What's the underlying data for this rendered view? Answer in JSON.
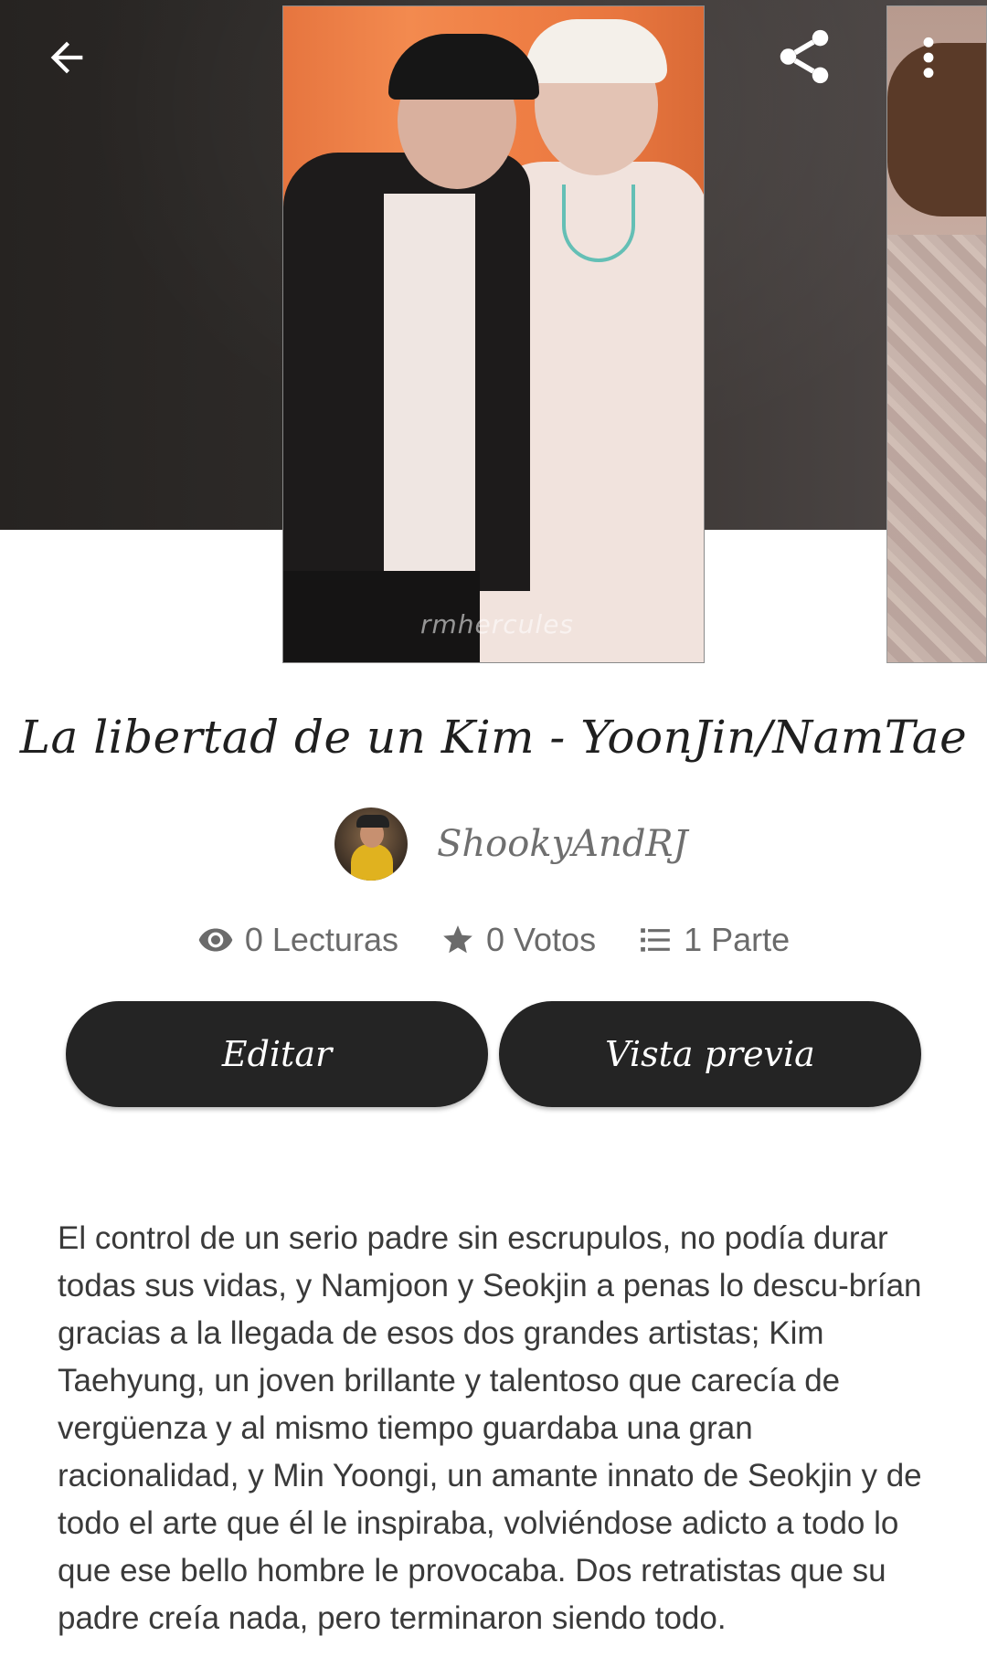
{
  "toolbar": {
    "back_icon": "arrow-left-icon",
    "share_icon": "share-icon",
    "more_icon": "more-vertical-icon"
  },
  "cover": {
    "watermark": "rmhercules"
  },
  "story": {
    "title": "La libertad de un Kim - YoonJin/NamTae",
    "author": "ShookyAndRJ",
    "stats": {
      "reads": "0 Lecturas",
      "votes": "0 Votos",
      "parts": "1 Parte"
    },
    "buttons": {
      "edit": "Editar",
      "preview": "Vista previa"
    },
    "synopsis": "El control de un serio padre sin escrupulos, no podía durar todas sus vidas, y Namjoon y Seokjin a penas lo descu-brían gracias a la llegada de esos dos grandes artistas; Kim Taehyung, un joven brillante y talentoso que carecía de vergüenza y al mismo tiempo guardaba una gran racionalidad, y Min Yoongi, un amante innato de Seokjin y de todo el arte que él le inspiraba, volviéndose adicto a todo lo que ese bello hombre le provocaba. Dos retratistas que su padre creía nada, pero terminaron siendo todo."
  },
  "colors": {
    "button_bg": "#242424",
    "button_text": "#ffffff",
    "stat_text": "#6b6b6b",
    "cover_backdrop": "#e6753f"
  }
}
